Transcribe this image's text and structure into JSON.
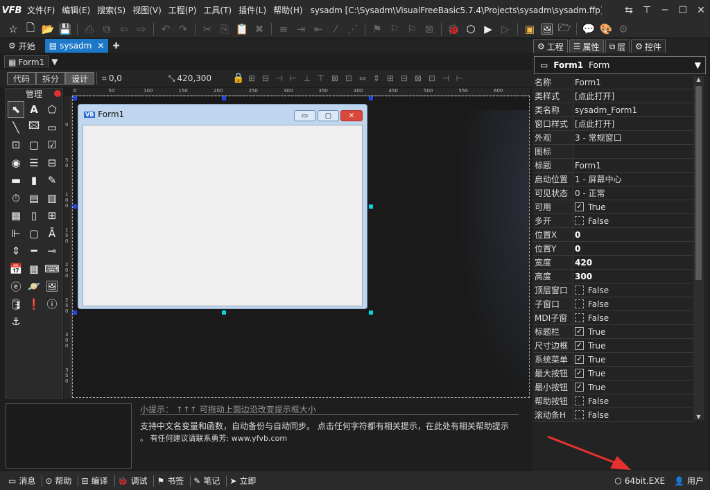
{
  "app": {
    "logo": "VFB",
    "title": "sysadm [C:\\Sysadm\\VisualFreeBasic5.7.4\\Projects\\sysadm\\sysadm.ffp] - ..."
  },
  "menu": [
    "文件(F)",
    "编辑(E)",
    "搜索(S)",
    "视图(V)",
    "工程(P)",
    "工具(T)",
    "插件(L)",
    "帮助(H)"
  ],
  "doc_tabs": [
    {
      "label": "开始"
    },
    {
      "label": "sysadm",
      "close": "✕"
    }
  ],
  "sub_tab": "Form1",
  "design_bar": {
    "modes": [
      "代码",
      "拆分",
      "设计"
    ],
    "pos": "0,0",
    "size": "420,300"
  },
  "palette": {
    "title": "管理"
  },
  "ruler": {
    "top": [
      "0",
      "50",
      "100",
      "150",
      "200",
      "250",
      "300",
      "350",
      "400",
      "450",
      "500",
      "550",
      "600"
    ],
    "left": [
      "0",
      "50",
      "100",
      "150",
      "200",
      "250",
      "300",
      "350"
    ]
  },
  "form": {
    "title": "Form1",
    "min": "▭",
    "max": "▢",
    "close": "✕"
  },
  "hint": {
    "title": "小提示：  ↑↑↑  可拖动上面边沿改变提示框大小",
    "line1": "支持中文名变量和函数，自动备份与自动同步。 点击任何字符都有相关提示，在此处有相关帮助提示",
    "line2": "。 有任何建议请联系勇芳: www.yfvb.com"
  },
  "status": [
    {
      "icon": "message-icon",
      "label": "消息"
    },
    {
      "icon": "help-icon",
      "label": "帮助"
    },
    {
      "icon": "compile-icon",
      "label": "编译"
    },
    {
      "icon": "debug-icon",
      "label": "调试"
    },
    {
      "icon": "bookmark-icon",
      "label": "书签"
    },
    {
      "icon": "note-icon",
      "label": "笔记"
    },
    {
      "icon": "send-icon",
      "label": "立即"
    }
  ],
  "status_right": {
    "build": "64bit.EXE",
    "user": "用户"
  },
  "right_tabs": [
    "工程",
    "属性",
    "层",
    "控件"
  ],
  "object": {
    "name": "Form1",
    "type": "Form"
  },
  "props": [
    {
      "k": "名称",
      "v": "Form1"
    },
    {
      "k": "类样式",
      "v": "[点此打开]"
    },
    {
      "k": "类名称",
      "v": "sysadm_Form1"
    },
    {
      "k": "窗口样式",
      "v": "[点此打开]"
    },
    {
      "k": "外观",
      "v": "3 - 常规窗口"
    },
    {
      "k": "图标",
      "v": ""
    },
    {
      "k": "标题",
      "v": "Form1"
    },
    {
      "k": "启动位置",
      "v": "1 - 屏幕中心"
    },
    {
      "k": "可见状态",
      "v": "0 - 正常"
    },
    {
      "k": "可用",
      "v": "True",
      "cb": true
    },
    {
      "k": "多开",
      "v": "False",
      "cb": false
    },
    {
      "k": "位置X",
      "v": "0",
      "bold": true
    },
    {
      "k": "位置Y",
      "v": "0",
      "bold": true
    },
    {
      "k": "宽度",
      "v": "420",
      "bold": true
    },
    {
      "k": "高度",
      "v": "300",
      "bold": true
    },
    {
      "k": "顶层窗口",
      "v": "False",
      "cb": false
    },
    {
      "k": "子窗口",
      "v": "False",
      "cb": false
    },
    {
      "k": "MDI子窗",
      "v": "False",
      "cb": false
    },
    {
      "k": "标题栏",
      "v": "True",
      "cb": true
    },
    {
      "k": "尺寸边框",
      "v": "True",
      "cb": true
    },
    {
      "k": "系统菜单",
      "v": "True",
      "cb": true
    },
    {
      "k": "最大按钮",
      "v": "True",
      "cb": true
    },
    {
      "k": "最小按钮",
      "v": "True",
      "cb": true
    },
    {
      "k": "帮助按钮",
      "v": "False",
      "cb": false
    },
    {
      "k": "滚动条H",
      "v": "False",
      "cb": false
    }
  ],
  "colors": {
    "accent": "#1c78c8",
    "arrow": "#e8312f"
  }
}
